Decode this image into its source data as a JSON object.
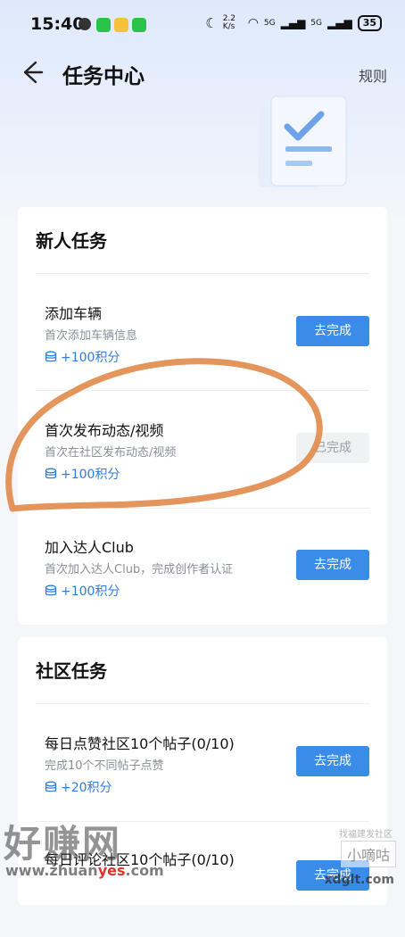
{
  "status_bar": {
    "time": "15:40",
    "net_speed": "2.2 K/s",
    "sig1": "5G",
    "sig2": "5G",
    "battery": "35"
  },
  "header": {
    "title": "任务中心",
    "rules_label": "规则"
  },
  "sections": [
    {
      "title": "新人任务",
      "tasks": [
        {
          "name": "添加车辆",
          "desc": "首次添加车辆信息",
          "reward": "+100积分",
          "button": "去完成",
          "state": "todo"
        },
        {
          "name": "首次发布动态/视频",
          "desc": "首次在社区发布动态/视频",
          "reward": "+100积分",
          "button": "已完成",
          "state": "done"
        },
        {
          "name": "加入达人Club",
          "desc": "首次加入达人Club，完成创作者认证",
          "reward": "+100积分",
          "button": "去完成",
          "state": "todo"
        }
      ]
    },
    {
      "title": "社区任务",
      "tasks": [
        {
          "name": "每日点赞社区10个帖子(0/10)",
          "desc": "完成10个不同帖子点赞",
          "reward": "+20积分",
          "button": "去完成",
          "state": "todo"
        },
        {
          "name": "每日评论社区10个帖子(0/10)",
          "desc": "",
          "reward": "",
          "button": "去完成",
          "state": "todo"
        }
      ]
    }
  ],
  "watermark": {
    "big": "好赚网",
    "url_pre": "www.zhuan",
    "url_hl": "yes",
    "url_post": ".com",
    "small": "找福建发社区",
    "box": "小嘀咕",
    "site": "xdglt.com"
  },
  "colors": {
    "accent": "#3b8be8",
    "reward": "#2f7de1",
    "annotation": "#e0894a"
  },
  "icons": [
    "back-arrow-icon",
    "document-check-icon",
    "coin-stack-icon"
  ]
}
